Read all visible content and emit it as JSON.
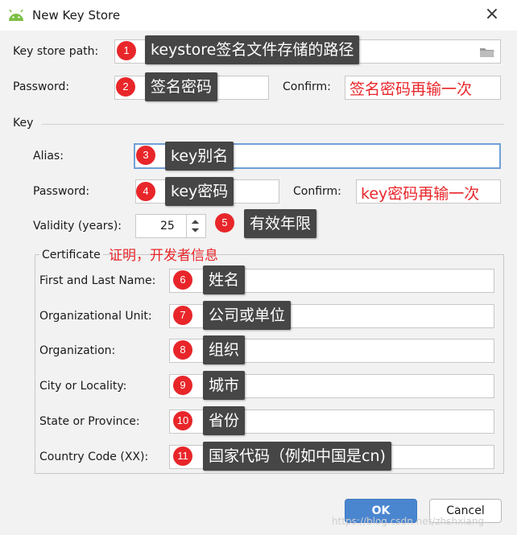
{
  "window": {
    "title": "New Key Store"
  },
  "keystore": {
    "path_label": "Key store path:",
    "password_label": "Password:",
    "confirm_label": "Confirm:"
  },
  "key": {
    "section_label": "Key",
    "alias_label": "Alias:",
    "password_label": "Password:",
    "confirm_label": "Confirm:",
    "validity_label": "Validity (years):",
    "validity_value": "25"
  },
  "certificate": {
    "section_label": "Certificate",
    "first_last_label": "First and Last Name:",
    "org_unit_label": "Organizational Unit:",
    "organization_label": "Organization:",
    "city_label": "City or Locality:",
    "state_label": "State or Province:",
    "country_label": "Country Code (XX):"
  },
  "buttons": {
    "ok": "OK",
    "cancel": "Cancel"
  },
  "annotations": {
    "a1": {
      "num": "1",
      "text": "keystore签名文件存储的路径"
    },
    "a2": {
      "num": "2",
      "text": "签名密码"
    },
    "a2_confirm": "签名密码再输一次",
    "a3": {
      "num": "3",
      "text": "key别名"
    },
    "a4": {
      "num": "4",
      "text": "key密码"
    },
    "a4_confirm": "key密码再输一次",
    "a5": {
      "num": "5",
      "text": "有效年限"
    },
    "cert_note": "证明，开发者信息",
    "a6": {
      "num": "6",
      "text": "姓名"
    },
    "a7": {
      "num": "7",
      "text": "公司或单位"
    },
    "a8": {
      "num": "8",
      "text": "组织"
    },
    "a9": {
      "num": "9",
      "text": "城市"
    },
    "a10": {
      "num": "10",
      "text": "省份"
    },
    "a11": {
      "num": "11",
      "text": "国家代码（例如中国是cn)"
    }
  },
  "watermark": "https://blog.csdn.net/zhshxiang",
  "colors": {
    "annotation_bg": "#464646",
    "badge_red": "#e8262a",
    "ok_blue": "#4a86d0"
  }
}
